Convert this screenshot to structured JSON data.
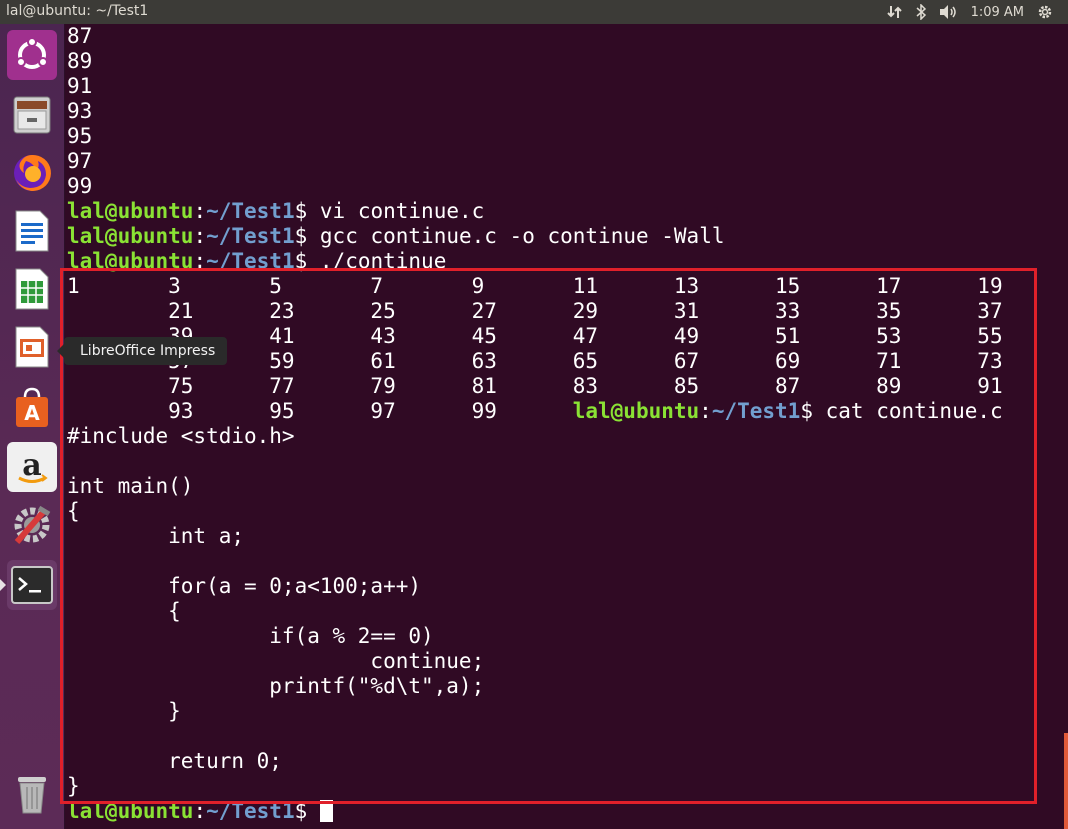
{
  "topbar": {
    "window_title": "lal@ubuntu: ~/Test1",
    "tray": {
      "network_icon": "network-updown-icon",
      "bluetooth_icon": "bluetooth-icon",
      "volume_icon": "volume-icon",
      "time": "1:09 AM",
      "settings_icon": "gear-icon"
    }
  },
  "launcher": {
    "items": [
      {
        "name": "ubuntu-dash",
        "icon": "ubuntu-logo-icon"
      },
      {
        "name": "files",
        "icon": "file-cabinet-icon"
      },
      {
        "name": "firefox",
        "icon": "firefox-icon"
      },
      {
        "name": "libreoffice-writer",
        "icon": "writer-document-icon"
      },
      {
        "name": "libreoffice-calc",
        "icon": "calc-spreadsheet-icon"
      },
      {
        "name": "libreoffice-impress",
        "icon": "impress-presentation-icon"
      },
      {
        "name": "ubuntu-software",
        "icon": "shopping-bag-icon"
      },
      {
        "name": "amazon",
        "icon": "amazon-icon"
      },
      {
        "name": "system-settings",
        "icon": "settings-tools-icon"
      },
      {
        "name": "terminal",
        "icon": "terminal-icon"
      },
      {
        "name": "trash",
        "icon": "trash-icon"
      }
    ],
    "tooltip": "LibreOffice Impress"
  },
  "prompt": {
    "user": "lal@ubuntu",
    "colon": ":",
    "path": "~/Test1",
    "sign": "$ "
  },
  "terminal": {
    "lines": [
      {
        "type": "out",
        "text": "87"
      },
      {
        "type": "out",
        "text": "89"
      },
      {
        "type": "out",
        "text": "91"
      },
      {
        "type": "out",
        "text": "93"
      },
      {
        "type": "out",
        "text": "95"
      },
      {
        "type": "out",
        "text": "97"
      },
      {
        "type": "out",
        "text": "99"
      },
      {
        "type": "cmd",
        "text": "vi continue.c"
      },
      {
        "type": "cmd",
        "text": "gcc continue.c -o continue -Wall"
      },
      {
        "type": "cmd",
        "text": "./continue"
      },
      {
        "type": "out",
        "text": "1       3       5       7       9       11      13      15      17      19"
      },
      {
        "type": "out",
        "text": "        21      23      25      27      29      31      33      35      37"
      },
      {
        "type": "out",
        "text": "        39      41      43      45      47      49      51      53      55"
      },
      {
        "type": "out",
        "text": "        57      59      61      63      65      67      69      71      73"
      },
      {
        "type": "out",
        "text": "        75      77      79      81      83      85      87      89      91"
      },
      {
        "type": "mixed",
        "text": "        93      95      97      99      ",
        "cmd": "cat continue.c"
      },
      {
        "type": "out",
        "text": "#include <stdio.h>"
      },
      {
        "type": "out",
        "text": ""
      },
      {
        "type": "out",
        "text": "int main()"
      },
      {
        "type": "out",
        "text": "{"
      },
      {
        "type": "out",
        "text": "        int a;"
      },
      {
        "type": "out",
        "text": ""
      },
      {
        "type": "out",
        "text": "        for(a = 0;a<100;a++)"
      },
      {
        "type": "out",
        "text": "        {"
      },
      {
        "type": "out",
        "text": "                if(a % 2== 0)"
      },
      {
        "type": "out",
        "text": "                        continue;"
      },
      {
        "type": "out",
        "text": "                printf(\"%d\\t\",a);"
      },
      {
        "type": "out",
        "text": "        }"
      },
      {
        "type": "out",
        "text": ""
      },
      {
        "type": "out",
        "text": "        return 0;"
      },
      {
        "type": "out",
        "text": "}"
      },
      {
        "type": "cursor",
        "text": ""
      }
    ]
  },
  "colors": {
    "terminal_bg": "#300a24",
    "prompt_user": "#8ae234",
    "prompt_path": "#729fcf",
    "highlight_box": "#e0202a"
  }
}
